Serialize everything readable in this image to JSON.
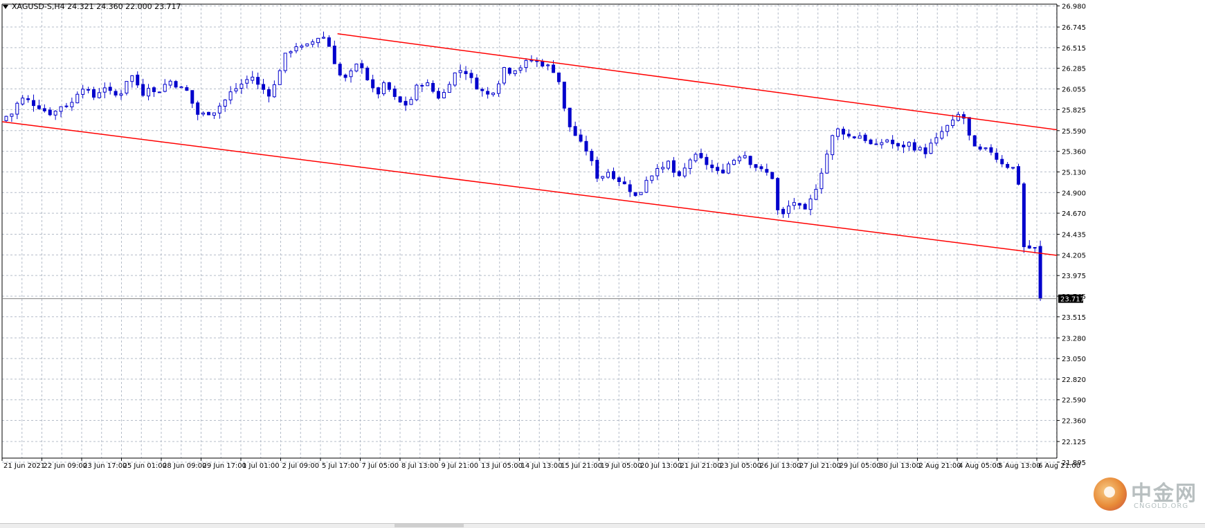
{
  "window": {
    "symbol_info": "XAGUSD-S,H4  24.321 24.360 22.000 23.717"
  },
  "watermark": {
    "name_cn": "中金网",
    "name_en": "CNGOLD.ORG"
  },
  "chart_data": {
    "type": "candlestick",
    "symbol": "XAGUSD-S",
    "timeframe": "H4",
    "current_price": 23.717,
    "current_price_label": "23.717",
    "ylim": [
      21.94,
      27.0
    ],
    "grid": true,
    "y_ticks": [
      "26.980",
      "26.745",
      "26.515",
      "26.285",
      "26.055",
      "25.825",
      "25.590",
      "25.360",
      "25.130",
      "24.900",
      "24.670",
      "24.435",
      "24.205",
      "23.975",
      "23.745",
      "23.515",
      "23.280",
      "23.050",
      "22.820",
      "22.590",
      "22.360",
      "22.125",
      "21.895"
    ],
    "x_ticks": [
      "21 Jun 2021",
      "22 Jun 09:00",
      "23 Jun 17:00",
      "25 Jun 01:00",
      "28 Jun 09:00",
      "29 Jun 17:00",
      "1 Jul 01:00",
      "2 Jul 09:00",
      "5 Jul 17:00",
      "7 Jul 05:00",
      "8 Jul 13:00",
      "9 Jul 21:00",
      "13 Jul 05:00",
      "14 Jul 13:00",
      "15 Jul 21:00",
      "19 Jul 05:00",
      "20 Jul 13:00",
      "21 Jul 21:00",
      "23 Jul 05:00",
      "26 Jul 13:00",
      "27 Jul 21:00",
      "29 Jul 05:00",
      "30 Jul 13:00",
      "2 Aug 21:00",
      "4 Aug 05:00",
      "5 Aug 13:00",
      "6 Aug 21:00"
    ],
    "bull_color": "#ffffff",
    "bear_color": "#0000cc",
    "wick_color": "#0000cc",
    "trendline_color": "#ff0000",
    "close_path": [
      25.75,
      25.78,
      25.9,
      25.95,
      25.92,
      25.88,
      25.85,
      25.8,
      25.78,
      25.82,
      25.9,
      25.85,
      25.95,
      26.1,
      26.05,
      25.95,
      26.0,
      26.1,
      26.02,
      25.98,
      26.0,
      26.15,
      26.2,
      26.1,
      26.0,
      26.1,
      26.0,
      26.05,
      26.12,
      26.15,
      26.08,
      26.05,
      26.02,
      25.8,
      25.75,
      25.8,
      25.78,
      25.85,
      25.9,
      26.0,
      26.05,
      26.1,
      26.15,
      26.2,
      26.1,
      26.05,
      26.0,
      26.1,
      26.3,
      26.45,
      26.5,
      26.55,
      26.5,
      26.55,
      26.6,
      26.65,
      26.62,
      26.45,
      26.25,
      26.15,
      26.2,
      26.3,
      26.35,
      26.2,
      26.05,
      26.0,
      26.1,
      26.05,
      25.95,
      25.9,
      25.88,
      25.95,
      26.1,
      26.12,
      26.1,
      26.0,
      25.95,
      26.05,
      26.2,
      26.25,
      26.28,
      26.2,
      26.1,
      26.05,
      25.98,
      26.02,
      26.1,
      26.3,
      26.25,
      26.28,
      26.3,
      26.35,
      26.38,
      26.35,
      26.33,
      26.3,
      26.25,
      26.1,
      25.7,
      25.6,
      25.5,
      25.4,
      25.35,
      25.1,
      25.05,
      25.15,
      25.1,
      25.05,
      25.0,
      24.95,
      24.85,
      24.9,
      25.05,
      25.1,
      25.2,
      25.15,
      25.25,
      25.1,
      25.05,
      25.2,
      25.3,
      25.3,
      25.25,
      25.2,
      25.15,
      25.1,
      25.2,
      25.25,
      25.3,
      25.35,
      25.25,
      25.2,
      25.15,
      25.12,
      25.1,
      24.7,
      24.65,
      24.75,
      24.8,
      24.72,
      24.68,
      24.85,
      25.0,
      25.2,
      25.4,
      25.6,
      25.6,
      25.55,
      25.5,
      25.55,
      25.52,
      25.45,
      25.4,
      25.45,
      25.5,
      25.45,
      25.4,
      25.42,
      25.45,
      25.4,
      25.38,
      25.35,
      25.45,
      25.5,
      25.6,
      25.65,
      25.7,
      25.8,
      25.68,
      25.4,
      25.38,
      25.35,
      25.4,
      25.3,
      25.25,
      25.2,
      25.18,
      25.15,
      24.3,
      24.28,
      24.3,
      23.717
    ],
    "candle_count": 190,
    "channel_upper": {
      "from": [
        0.318,
        26.67
      ],
      "to": [
        1.0,
        25.6
      ]
    },
    "channel_lower": {
      "from": [
        0.0,
        25.69
      ],
      "to": [
        1.0,
        24.2
      ]
    }
  }
}
